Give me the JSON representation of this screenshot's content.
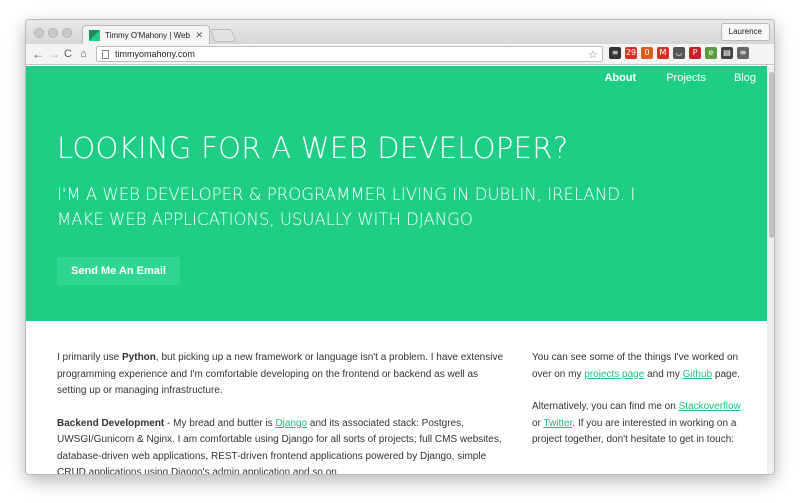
{
  "browser": {
    "tab_title": "Timmy O'Mahony | Web De",
    "tab_close": "✕",
    "profile_name": "Laurence",
    "url": "timmyomahony.com",
    "nav_back": "←",
    "nav_forward": "→",
    "nav_reload": "C",
    "nav_home": "⌂",
    "star": "☆",
    "extensions": [
      {
        "icon": "buffer-icon",
        "color": "#333333",
        "glyph": "≡"
      },
      {
        "icon": "calendar-icon",
        "color": "#d93025",
        "glyph": "29"
      },
      {
        "icon": "shield-icon",
        "color": "#e05a1e",
        "glyph": "0"
      },
      {
        "icon": "gmail-icon",
        "color": "#d93025",
        "glyph": "M"
      },
      {
        "icon": "pocket-icon",
        "color": "#555555",
        "glyph": "◡"
      },
      {
        "icon": "pinterest-icon",
        "color": "#cb2027",
        "glyph": "P"
      },
      {
        "icon": "evernote-icon",
        "color": "#5a9b3e",
        "glyph": "e"
      },
      {
        "icon": "card-icon",
        "color": "#444444",
        "glyph": "▤"
      },
      {
        "icon": "menu-icon",
        "color": "#666666",
        "glyph": "≡"
      }
    ]
  },
  "nav": {
    "about": "About",
    "projects": "Projects",
    "blog": "Blog"
  },
  "hero": {
    "headline": "LOOKING FOR A WEB DEVELOPER?",
    "subheadline": "I'M A WEB DEVELOPER & PROGRAMMER LIVING IN DUBLIN, IRELAND. I MAKE WEB APPLICATIONS, USUALLY WITH DJANGO",
    "cta": "Send Me An Email",
    "bg_color": "#1ece84"
  },
  "main": {
    "p1_a": "I primarily use ",
    "p1_b": "Python",
    "p1_c": ", but picking up a new framework or language isn't a problem. I have extensive programming experience and I'm comfortable developing on the frontend or backend as well as setting up or managing infrastructure.",
    "p2_a": "Backend Development",
    "p2_b": " - My bread and butter is ",
    "p2_link": "Django",
    "p2_c": " and its associated stack: Postgres, UWSGI/Gunicorn & Nginx. I am comfortable using Django for all sorts of projects; full CMS websites, database-driven web applications, REST-driven frontend applications powered by Django, simple CRUD applications using Django's admin application and so on."
  },
  "side": {
    "s1_a": "You can see some of the things I've worked on over on my ",
    "s1_link1": "projects page",
    "s1_b": " and my ",
    "s1_link2": "Github",
    "s1_c": " page.",
    "s2_a": "Alternatively, you can find me on ",
    "s2_link1": "Stackoverflow",
    "s2_b": " or ",
    "s2_link2": "Twitter",
    "s2_c": ". If you are interested in working on a project together, don't hesitate to get in touch:"
  },
  "colors": {
    "accent": "#1ece84",
    "link": "#1ec07c"
  }
}
